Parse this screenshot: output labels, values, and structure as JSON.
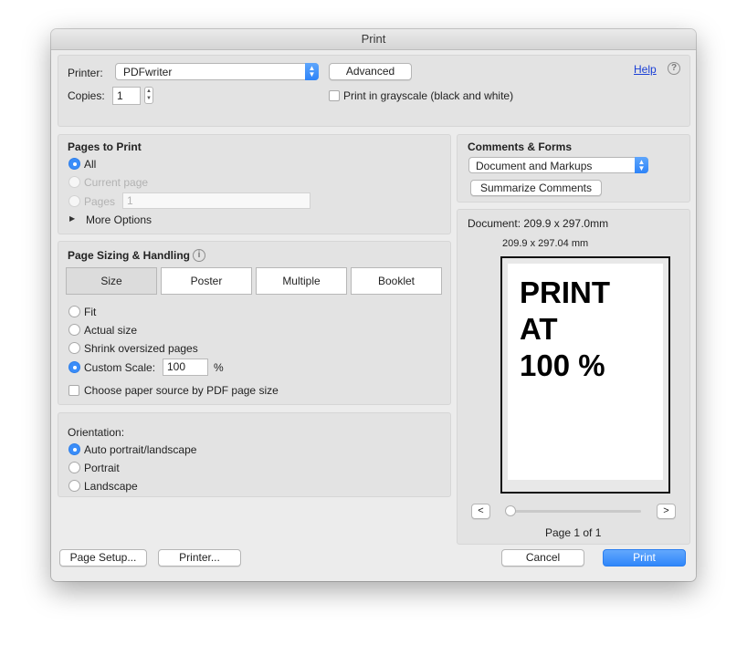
{
  "window": {
    "title": "Print"
  },
  "printer": {
    "label": "Printer:",
    "selected": "PDFwriter",
    "advanced_label": "Advanced",
    "help_label": "Help",
    "help_icon": "?"
  },
  "copies": {
    "label": "Copies:",
    "value": "1"
  },
  "grayscale": {
    "label": "Print in grayscale (black and white)",
    "checked": false
  },
  "pages_to_print": {
    "title": "Pages to Print",
    "all_label": "All",
    "current_label": "Current page",
    "pages_label": "Pages",
    "pages_value": "1",
    "more_options_label": "More Options"
  },
  "page_sizing": {
    "title": "Page Sizing & Handling",
    "info_icon": "i",
    "tabs": [
      "Size",
      "Poster",
      "Multiple",
      "Booklet"
    ],
    "active_tab": "Size",
    "fit_label": "Fit",
    "actual_label": "Actual size",
    "shrink_label": "Shrink oversized pages",
    "custom_label": "Custom Scale:",
    "custom_value": "100",
    "percent": "%",
    "paper_source_label": "Choose paper source by PDF page size"
  },
  "orientation": {
    "title": "Orientation:",
    "auto_label": "Auto portrait/landscape",
    "portrait_label": "Portrait",
    "landscape_label": "Landscape"
  },
  "comments_forms": {
    "title": "Comments & Forms",
    "selected": "Document and Markups",
    "summarize_label": "Summarize Comments"
  },
  "preview": {
    "document_size": "Document: 209.9 x 297.0mm",
    "page_size": "209.9 x 297.04 mm",
    "page_text": [
      "PRINT",
      "AT",
      "100 %"
    ],
    "prev_label": "<",
    "next_label": ">",
    "page_indicator": "Page 1 of 1"
  },
  "footer": {
    "page_setup_label": "Page Setup...",
    "printer_label": "Printer...",
    "cancel_label": "Cancel",
    "print_label": "Print"
  }
}
